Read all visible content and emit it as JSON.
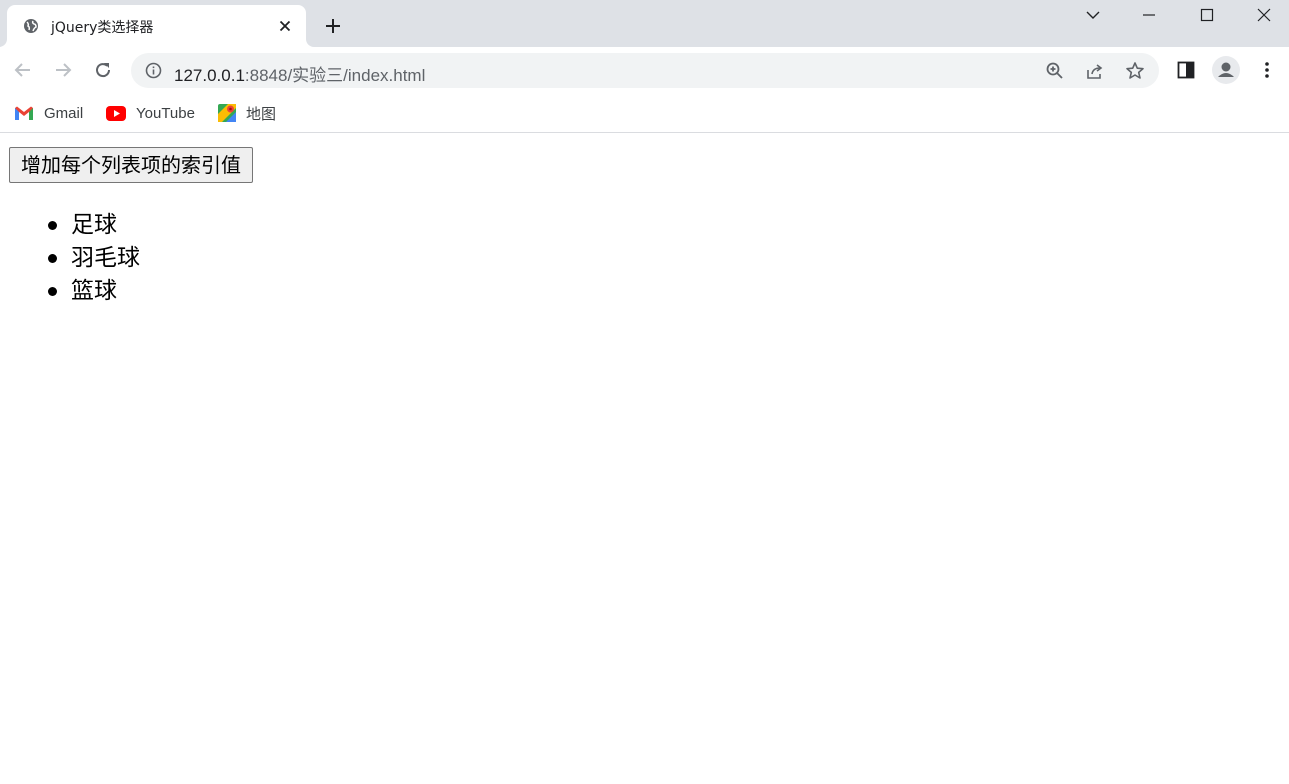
{
  "browser": {
    "tab": {
      "title": "jQuery类选择器"
    },
    "address_bar": {
      "host": "127.0.0.1",
      "path": ":8848/实验三/index.html"
    },
    "bookmarks": [
      {
        "label": "Gmail",
        "icon": "gmail-icon"
      },
      {
        "label": "YouTube",
        "icon": "youtube-icon"
      },
      {
        "label": "地图",
        "icon": "maps-icon"
      }
    ]
  },
  "page": {
    "button_label": "增加每个列表项的索引值",
    "items": [
      "足球",
      "羽毛球",
      "篮球"
    ]
  }
}
